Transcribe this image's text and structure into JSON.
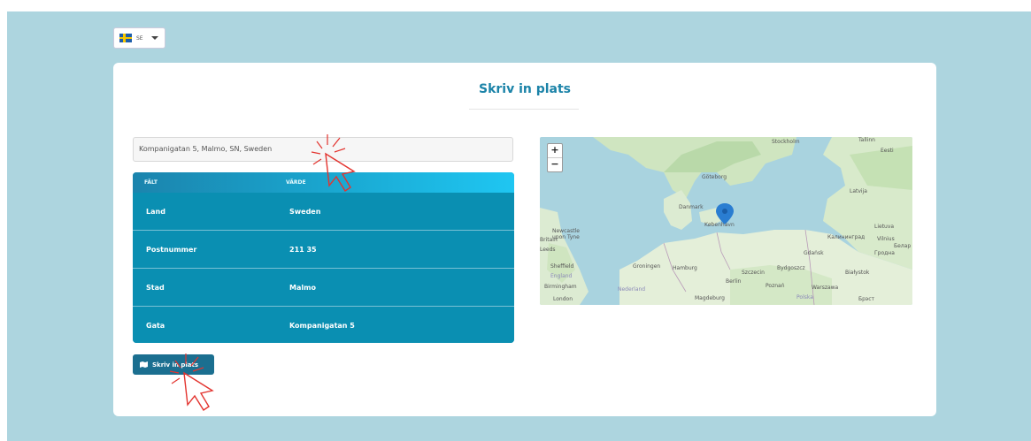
{
  "language": {
    "code": "SE"
  },
  "card": {
    "title": "Skriv in plats",
    "address_value": "Kompanigatan 5, Malmo, SN, Sweden",
    "table": {
      "headers": [
        "FÄLT",
        "VÄRDE"
      ],
      "rows": [
        {
          "field": "Land",
          "value": "Sweden"
        },
        {
          "field": "Postnummer",
          "value": "211 35"
        },
        {
          "field": "Stad",
          "value": "Malmo"
        },
        {
          "field": "Gata",
          "value": "Kompanigatan 5"
        }
      ]
    },
    "button_label": "Skriv in plats"
  },
  "map": {
    "zoom_in": "+",
    "zoom_out": "−",
    "labels": {
      "stockholm": "Stockholm",
      "tallinn": "Tallinn",
      "eesti": "Eesti",
      "latvija": "Latvija",
      "goteborg": "Göteborg",
      "danmark": "Danmark",
      "kobenhavn": "København",
      "lietuva": "Lietuva",
      "vilnius": "Vilnius",
      "kaliningrad": "Калининград",
      "gdansk": "Gdańsk",
      "newcastle": "Newcastle upon Tyne",
      "leeds": "Leeds",
      "sheffield": "Sheffield",
      "birmingham": "Birmingham",
      "london": "London",
      "groningen": "Groningen",
      "hamburg": "Hamburg",
      "szczecin": "Szczecin",
      "bydgoszcz": "Bydgoszcz",
      "berlin": "Berlin",
      "poznan": "Poznań",
      "warszawa": "Warszawa",
      "bialystok": "Białystok",
      "magdeburg": "Magdeburg",
      "nederland": "Nederland",
      "polska": "Polska",
      "britain": "Britain",
      "england": "England",
      "grodno": "Гродна",
      "brest": "Брэст",
      "belarus": "Белар"
    },
    "colors": {
      "water": "#a9d3df",
      "land": "#dcebd2",
      "forest": "#b9d9a9",
      "marker": "#2a7dd1"
    }
  },
  "accent_colors": {
    "title": "#1b83a8",
    "table": "#0a8fb2",
    "button": "#1b6f90",
    "background": "#add5df"
  }
}
